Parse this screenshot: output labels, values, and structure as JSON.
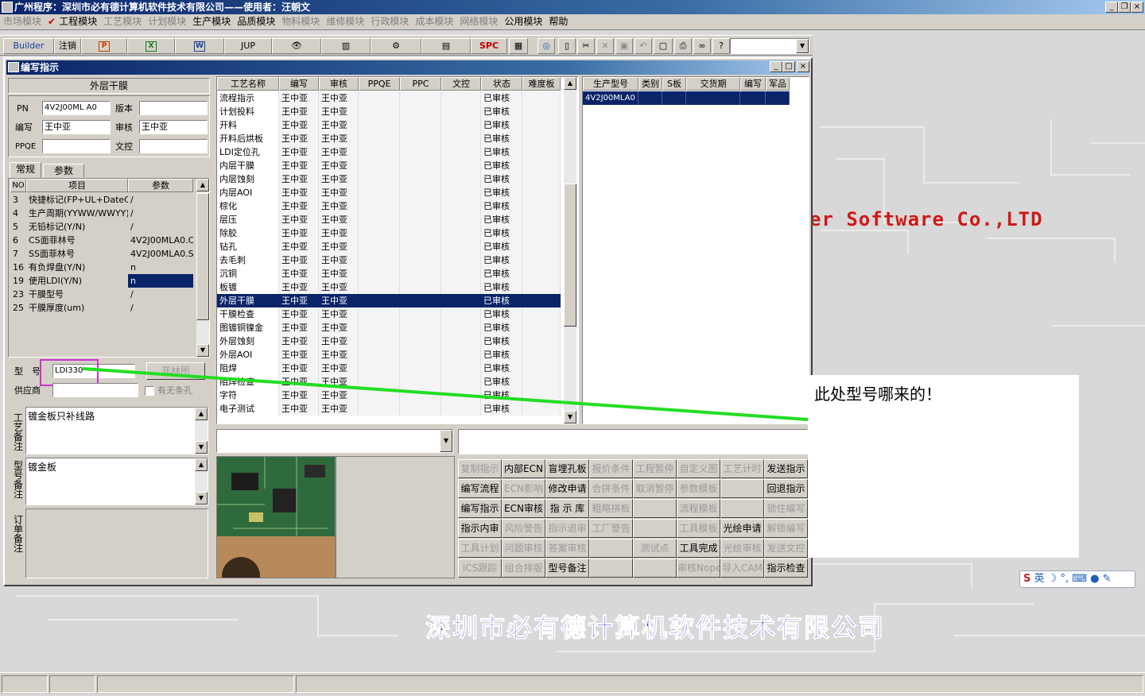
{
  "app_title": "广州程序：深圳市必有德计算机软件技术有限公司——使用者：汪朝文",
  "menu": [
    {
      "label": "市场模块",
      "enabled": false
    },
    {
      "label": "工程模块",
      "enabled": true,
      "checked": true
    },
    {
      "label": "工艺模块",
      "enabled": false
    },
    {
      "label": "计划模块",
      "enabled": false
    },
    {
      "label": "生产模块",
      "enabled": true
    },
    {
      "label": "品质模块",
      "enabled": true
    },
    {
      "label": "物料模块",
      "enabled": false
    },
    {
      "label": "维修模块",
      "enabled": false
    },
    {
      "label": "行政模块",
      "enabled": false
    },
    {
      "label": "成本模块",
      "enabled": false
    },
    {
      "label": "网络模块",
      "enabled": false
    },
    {
      "label": "公用模块",
      "enabled": true
    },
    {
      "label": "帮助",
      "enabled": true
    }
  ],
  "toolbar": {
    "builder": "Builder",
    "logout": "注销",
    "jup": "JUP",
    "spc": "SPC"
  },
  "window": {
    "title": "编写指示"
  },
  "left": {
    "section_title": "外层干膜",
    "pn_label": "PN",
    "pn": "4V2J00ML A0",
    "version_label": "版本",
    "version": "",
    "author_label": "编写",
    "author": "王中亚",
    "reviewer_label": "审核",
    "reviewer": "王中亚",
    "ppqe_label": "PPQE",
    "ppqe": "",
    "doc_label": "文控",
    "doc": "",
    "tabs": [
      "常规",
      "参数"
    ],
    "param_headers": [
      "NO",
      "项目",
      "参数"
    ],
    "params": [
      {
        "no": "3",
        "item": "快捷标记(FP+UL+DateC",
        "val": "/"
      },
      {
        "no": "4",
        "item": "生产周期(YYWW/WWYY)",
        "val": "/"
      },
      {
        "no": "5",
        "item": "无铅标记(Y/N)",
        "val": "/"
      },
      {
        "no": "6",
        "item": "CS面菲林号",
        "val": "4V2J00MLA0.CS"
      },
      {
        "no": "7",
        "item": "SS面菲林号",
        "val": "4V2J00MLA0.SS"
      },
      {
        "no": "16",
        "item": "有负焊盘(Y/N)",
        "val": "n"
      },
      {
        "no": "19",
        "item": "使用LDI(Y/N)",
        "val": "n"
      },
      {
        "no": "23",
        "item": "干膜型号",
        "val": "/"
      },
      {
        "no": "25",
        "item": "干膜厚度(um)",
        "val": "/"
      }
    ],
    "model_label": "型　号",
    "model": "LDI330",
    "film_button": "菲林图",
    "supplier_label": "供应商",
    "supplier": "",
    "no_barcode": "有无条孔",
    "process_note_label": "工艺备注",
    "process_note": "镀金板只补线路",
    "model_note_label": "型号备注",
    "model_note": "镀金板",
    "order_note_label": "订单备注",
    "order_note": ""
  },
  "process_grid": {
    "headers": [
      "工艺名称",
      "编写",
      "审核",
      "PPQE",
      "PPC",
      "文控",
      "状态",
      "难度板"
    ],
    "rows": [
      {
        "name": "流程指示",
        "a": "王中亚",
        "r": "王中亚",
        "s": "已审核"
      },
      {
        "name": "计划投料",
        "a": "王中亚",
        "r": "王中亚",
        "s": "已审核"
      },
      {
        "name": "开料",
        "a": "王中亚",
        "r": "王中亚",
        "s": "已审核"
      },
      {
        "name": "开料后烘板",
        "a": "王中亚",
        "r": "王中亚",
        "s": "已审核"
      },
      {
        "name": "LDI定位孔",
        "a": "王中亚",
        "r": "王中亚",
        "s": "已审核"
      },
      {
        "name": "内层干膜",
        "a": "王中亚",
        "r": "王中亚",
        "s": "已审核"
      },
      {
        "name": "内层蚀刻",
        "a": "王中亚",
        "r": "王中亚",
        "s": "已审核"
      },
      {
        "name": "内层AOI",
        "a": "王中亚",
        "r": "王中亚",
        "s": "已审核"
      },
      {
        "name": "棕化",
        "a": "王中亚",
        "r": "王中亚",
        "s": "已审核"
      },
      {
        "name": "层压",
        "a": "王中亚",
        "r": "王中亚",
        "s": "已审核"
      },
      {
        "name": "除胶",
        "a": "王中亚",
        "r": "王中亚",
        "s": "已审核"
      },
      {
        "name": "钻孔",
        "a": "王中亚",
        "r": "王中亚",
        "s": "已审核"
      },
      {
        "name": "去毛刺",
        "a": "王中亚",
        "r": "王中亚",
        "s": "已审核"
      },
      {
        "name": "沉铜",
        "a": "王中亚",
        "r": "王中亚",
        "s": "已审核"
      },
      {
        "name": "板镀",
        "a": "王中亚",
        "r": "王中亚",
        "s": "已审核"
      },
      {
        "name": "外层干膜",
        "a": "王中亚",
        "r": "王中亚",
        "s": "已审核",
        "selected": true
      },
      {
        "name": "干膜检查",
        "a": "王中亚",
        "r": "王中亚",
        "s": "已审核"
      },
      {
        "name": "图镀铜镍金",
        "a": "王中亚",
        "r": "王中亚",
        "s": "已审核"
      },
      {
        "name": "外层蚀刻",
        "a": "王中亚",
        "r": "王中亚",
        "s": "已审核"
      },
      {
        "name": "外层AOI",
        "a": "王中亚",
        "r": "王中亚",
        "s": "已审核"
      },
      {
        "name": "阻焊",
        "a": "王中亚",
        "r": "王中亚",
        "s": "已审核"
      },
      {
        "name": "阻焊检查",
        "a": "王中亚",
        "r": "王中亚",
        "s": "已审核"
      },
      {
        "name": "字符",
        "a": "王中亚",
        "r": "王中亚",
        "s": "已审核"
      },
      {
        "name": "电子测试",
        "a": "王中亚",
        "r": "王中亚",
        "s": "已审核"
      }
    ]
  },
  "product_grid": {
    "headers": [
      "生产型号",
      "类别",
      "S板",
      "交货期",
      "编写",
      "军品"
    ],
    "rows": [
      {
        "model": "4V2J00MLA0"
      }
    ]
  },
  "buttons": [
    [
      {
        "t": "复制指示",
        "e": false
      },
      {
        "t": "内部ECN",
        "e": true
      },
      {
        "t": "盲埋孔板",
        "e": true
      },
      {
        "t": "报价条件",
        "e": false
      },
      {
        "t": "工程暂停",
        "e": false
      },
      {
        "t": "自定义图",
        "e": false
      },
      {
        "t": "工艺计时",
        "e": false
      },
      {
        "t": "发送指示",
        "e": true
      }
    ],
    [
      {
        "t": "编写流程",
        "e": true
      },
      {
        "t": "ECN影响",
        "e": false
      },
      {
        "t": "修改申请",
        "e": true
      },
      {
        "t": "合拼条件",
        "e": false
      },
      {
        "t": "取消暂停",
        "e": false
      },
      {
        "t": "参数模板",
        "e": false
      },
      {
        "t": "",
        "e": false
      },
      {
        "t": "回退指示",
        "e": true
      }
    ],
    [
      {
        "t": "编写指示",
        "e": true
      },
      {
        "t": "ECN审核",
        "e": true
      },
      {
        "t": "指 示 库",
        "e": true
      },
      {
        "t": "粗略拼板",
        "e": false
      },
      {
        "t": "",
        "e": false
      },
      {
        "t": "流程模板",
        "e": false
      },
      {
        "t": "",
        "e": false
      },
      {
        "t": "锁住编写",
        "e": false
      }
    ],
    [
      {
        "t": "指示内审",
        "e": true
      },
      {
        "t": "风险警告",
        "e": false
      },
      {
        "t": "指示退审",
        "e": false
      },
      {
        "t": "工厂警告",
        "e": false
      },
      {
        "t": "",
        "e": false
      },
      {
        "t": "工具模板",
        "e": false
      },
      {
        "t": "光绘申请",
        "e": true
      },
      {
        "t": "解锁编写",
        "e": false
      }
    ],
    [
      {
        "t": "工具计划",
        "e": false
      },
      {
        "t": "问题审核",
        "e": false
      },
      {
        "t": "答案审核",
        "e": false
      },
      {
        "t": "",
        "e": false
      },
      {
        "t": "测试点",
        "e": false
      },
      {
        "t": "工具完成",
        "e": true
      },
      {
        "t": "光绘审核",
        "e": false
      },
      {
        "t": "发送文控",
        "e": false
      }
    ],
    [
      {
        "t": "ICS跟踪",
        "e": false
      },
      {
        "t": "组合排版",
        "e": false
      },
      {
        "t": "型号备注",
        "e": true
      },
      {
        "t": "",
        "e": false
      },
      {
        "t": "",
        "e": false
      },
      {
        "t": "审核Nope",
        "e": false
      },
      {
        "t": "导入CAM",
        "e": false
      },
      {
        "t": "指示检查",
        "e": true
      }
    ]
  ],
  "brand_en": "er Software Co.,LTD",
  "brand_zh": "深圳市必有德计算机软件技术有限公司",
  "annotation": "此处型号哪来的！",
  "ime": "英",
  "colors": {
    "selection": "#0a246a",
    "annotation_line": "#22dd22",
    "highlight_box": "#cc33cc",
    "brand_red": "#d01818",
    "brand_blue": "#3040d0"
  }
}
